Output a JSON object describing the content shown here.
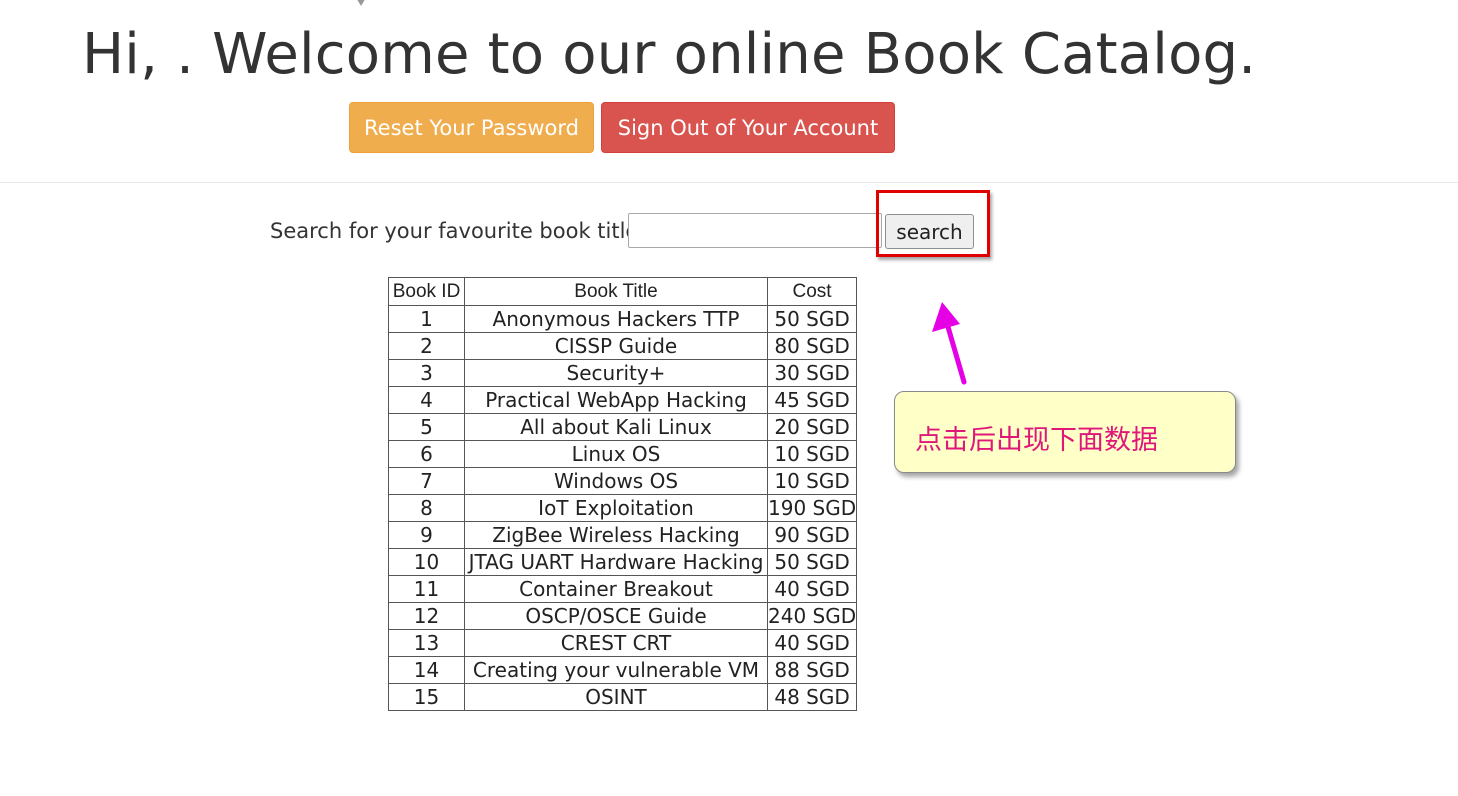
{
  "header": {
    "title": "Hi, . Welcome to our online Book Catalog.",
    "reset_password_label": "Reset Your Password",
    "sign_out_label": "Sign Out of Your Account"
  },
  "search": {
    "label": "Search for your favourite book title",
    "input_value": "",
    "button_label": "search"
  },
  "table": {
    "columns": [
      "Book ID",
      "Book Title",
      "Cost"
    ],
    "rows": [
      {
        "id": "1",
        "title": "Anonymous Hackers TTP",
        "cost": "50 SGD"
      },
      {
        "id": "2",
        "title": "CISSP Guide",
        "cost": "80 SGD"
      },
      {
        "id": "3",
        "title": "Security+",
        "cost": "30 SGD"
      },
      {
        "id": "4",
        "title": "Practical WebApp Hacking",
        "cost": "45 SGD"
      },
      {
        "id": "5",
        "title": "All about Kali Linux",
        "cost": "20 SGD"
      },
      {
        "id": "6",
        "title": "Linux OS",
        "cost": "10 SGD"
      },
      {
        "id": "7",
        "title": "Windows OS",
        "cost": "10 SGD"
      },
      {
        "id": "8",
        "title": "IoT Exploitation",
        "cost": "190 SGD"
      },
      {
        "id": "9",
        "title": "ZigBee Wireless Hacking",
        "cost": "90 SGD"
      },
      {
        "id": "10",
        "title": "JTAG UART Hardware Hacking",
        "cost": "50 SGD"
      },
      {
        "id": "11",
        "title": "Container Breakout",
        "cost": "40 SGD"
      },
      {
        "id": "12",
        "title": "OSCP/OSCE Guide",
        "cost": "240 SGD"
      },
      {
        "id": "13",
        "title": "CREST CRT",
        "cost": "40 SGD"
      },
      {
        "id": "14",
        "title": "Creating your vulnerable VM",
        "cost": "88 SGD"
      },
      {
        "id": "15",
        "title": "OSINT",
        "cost": "48 SGD"
      }
    ]
  },
  "annotation": {
    "callout_text": "点击后出现下面数据",
    "callout_text_color": "#e0177a",
    "callout_background": "#ffffc8",
    "highlight_color": "#e10000",
    "arrow_color": "#e600e6"
  },
  "colors": {
    "warning_button": "#f0ad4e",
    "danger_button": "#d9534f"
  }
}
